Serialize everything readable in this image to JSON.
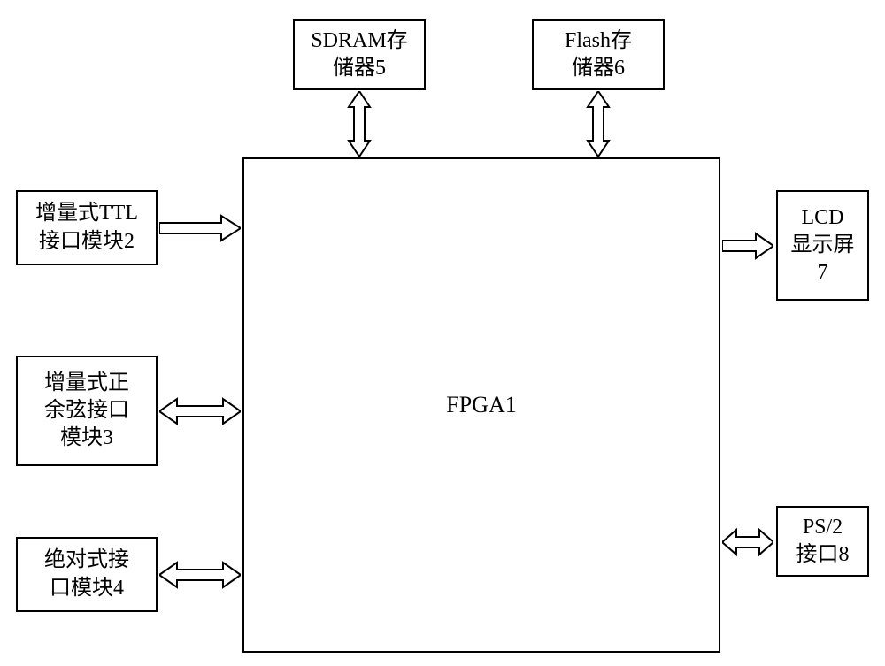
{
  "blocks": {
    "sdram": "SDRAM存\n储器5",
    "flash": "Flash存\n储器6",
    "ttl": "增量式TTL\n接口模块2",
    "sincos": "增量式正\n余弦接口\n模块3",
    "absolute": "绝对式接\n口模块4",
    "fpga": "FPGA1",
    "lcd": "LCD\n显示屏\n7",
    "ps2": "PS/2\n接口8"
  }
}
